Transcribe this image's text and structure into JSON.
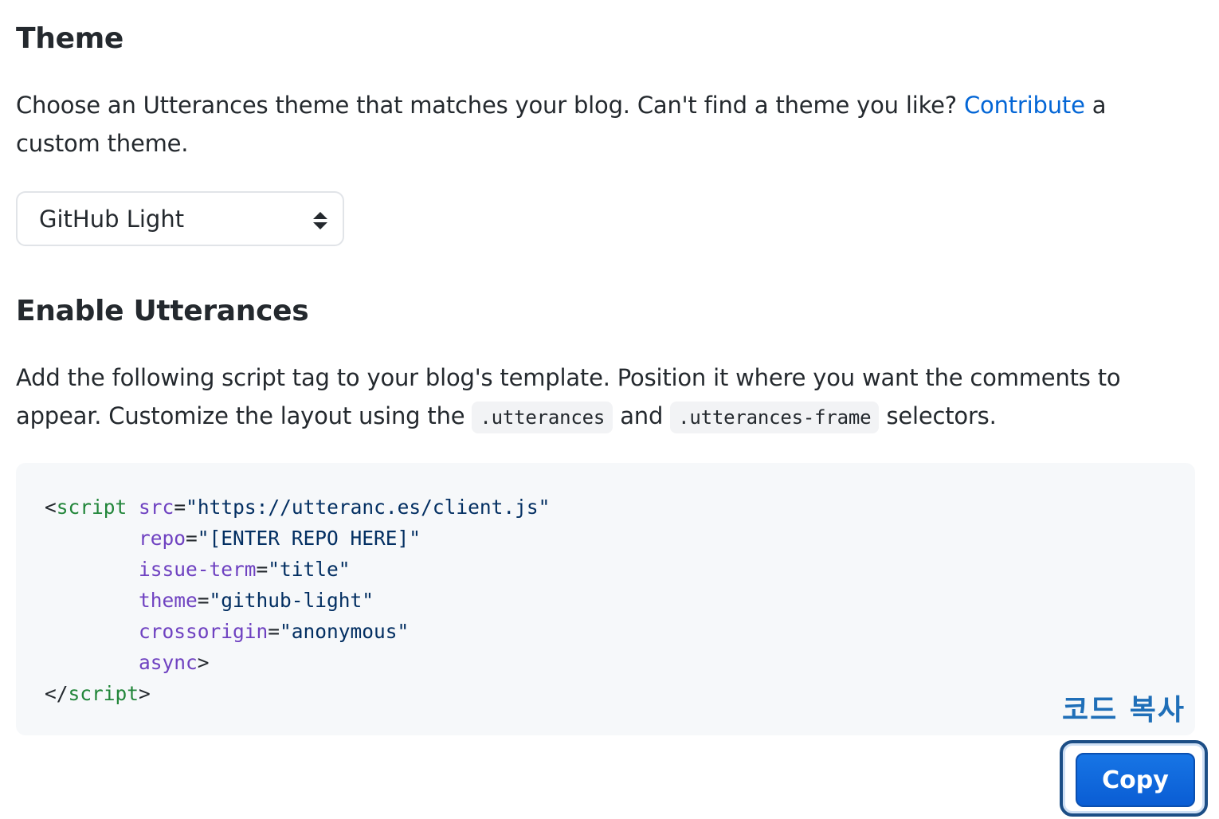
{
  "theme_section": {
    "title": "Theme",
    "description_before": "Choose an Utterances theme that matches your blog. Can't find a theme you like? ",
    "contribute_link": "Contribute",
    "description_after": " a custom theme.",
    "select_value": "GitHub Light"
  },
  "enable_section": {
    "title": "Enable Utterances",
    "description_1": "Add the following script tag to your blog's template. Position it where you want the comments to appear. Customize the layout using the ",
    "code_1": ".utterances",
    "description_and": " and ",
    "code_2": ".utterances-frame",
    "description_end": " selectors."
  },
  "code": {
    "open_tag": "script",
    "close_tag": "script",
    "src_attr": "src",
    "src_value": "\"https://utteranc.es/client.js\"",
    "repo_attr": "repo",
    "repo_value": "\"[ENTER REPO HERE]\"",
    "issue_attr": "issue-term",
    "issue_value": "\"title\"",
    "theme_attr": "theme",
    "theme_value": "\"github-light\"",
    "cross_attr": "crossorigin",
    "cross_value": "\"anonymous\"",
    "async_attr": "async"
  },
  "annotation": {
    "korean_label": "코드 복사"
  },
  "copy_button": {
    "label": "Copy"
  },
  "colors": {
    "link": "#0366d6",
    "button": "#0a5dd4",
    "code_bg": "#f6f8fa",
    "attr": "#6f42c1",
    "tag": "#22863a",
    "string": "#032f62"
  }
}
